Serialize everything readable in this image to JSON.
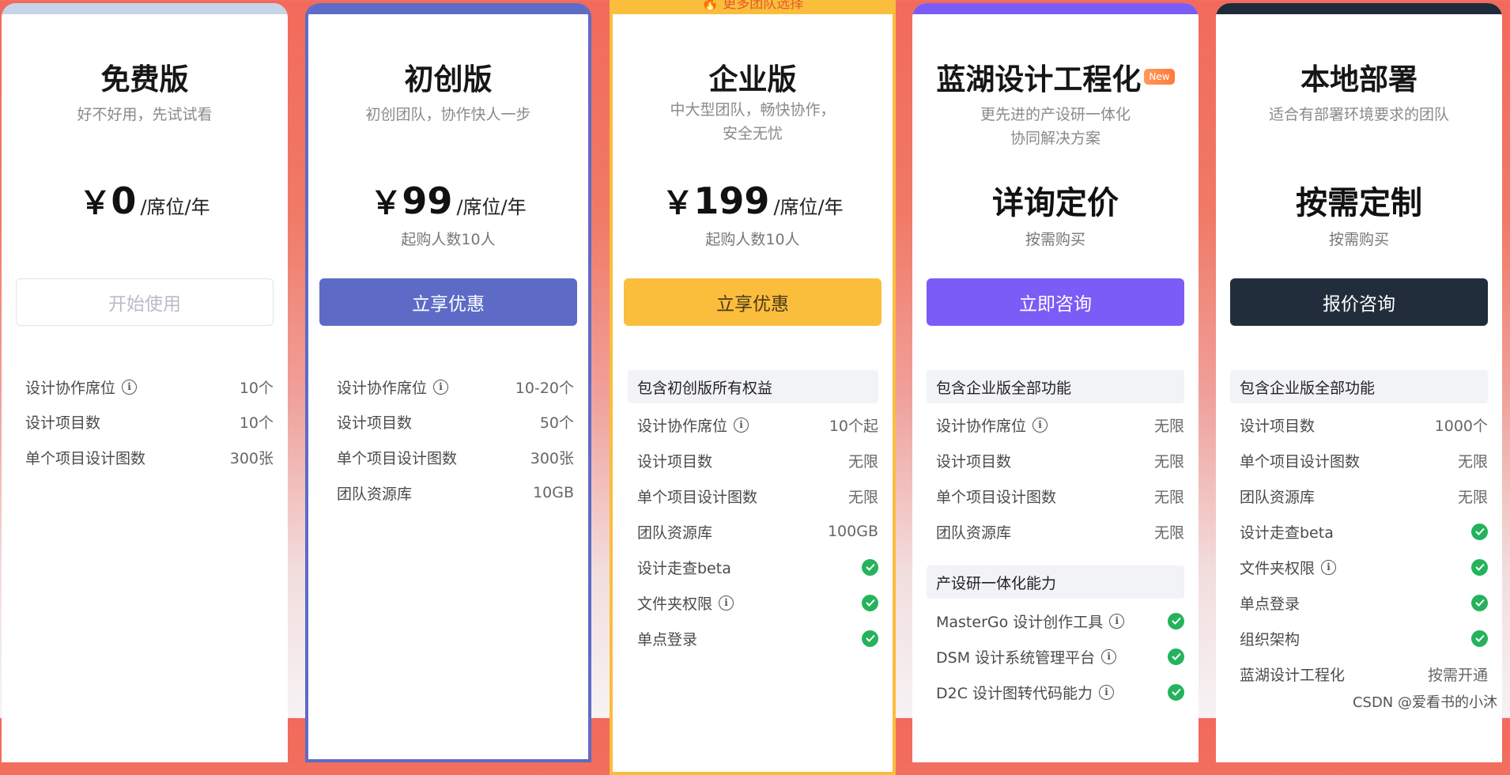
{
  "colors": {
    "free_accent": "#c7d3e6",
    "starter_accent": "#5d6bc6",
    "enterprise_accent": "#fbbd3c",
    "lanhu_accent": "#7b5cf6",
    "local_accent": "#1f2a3a",
    "check_green": "#24b35c"
  },
  "plans": {
    "free": {
      "name": "免费版",
      "desc": "好不好用，先试试看",
      "currency": "￥",
      "amount": "0",
      "unit": "/席位/年",
      "button": "开始使用",
      "features": [
        {
          "label": "设计协作席位",
          "value": "10个"
        },
        {
          "label": "设计项目数",
          "value": "10个"
        },
        {
          "label": "单个项目设计图数",
          "value": "300张"
        }
      ]
    },
    "starter": {
      "name": "初创版",
      "desc": "初创团队，协作快人一步",
      "currency": "￥",
      "amount": "99",
      "unit": "/席位/年",
      "note": "起购人数10人",
      "button": "立享优惠",
      "features": [
        {
          "label": "设计协作席位",
          "value": "10-20个"
        },
        {
          "label": "设计项目数",
          "value": "50个"
        },
        {
          "label": "单个项目设计图数",
          "value": "300张"
        },
        {
          "label": "团队资源库",
          "value": "10GB"
        }
      ]
    },
    "enterprise": {
      "name": "企业版",
      "desc": "中大型团队，畅快协作，\n安全无忧",
      "currency": "￥",
      "amount": "199",
      "unit": "/席位/年",
      "note": "起购人数10人",
      "button": "立享优惠",
      "section": "包含初创版所有权益",
      "features": [
        {
          "label": "设计协作席位",
          "value": "10个起"
        },
        {
          "label": "设计项目数",
          "value": "无限"
        },
        {
          "label": "单个项目设计图数",
          "value": "无限"
        },
        {
          "label": "团队资源库",
          "value": "100GB"
        },
        {
          "label": "设计走查beta",
          "value": ""
        },
        {
          "label": "文件夹权限",
          "value": ""
        },
        {
          "label": "单点登录",
          "value": ""
        }
      ]
    },
    "lanhu": {
      "name": "蓝湖设计工程化",
      "badge": "New",
      "desc": "更先进的产设研一体化\n协同解决方案",
      "price_text": "详询定价",
      "note": "按需购买",
      "button": "立即咨询",
      "section1": "包含企业版全部功能",
      "features": [
        {
          "label": "设计协作席位",
          "value": "无限"
        },
        {
          "label": "设计项目数",
          "value": "无限"
        },
        {
          "label": "单个项目设计图数",
          "value": "无限"
        },
        {
          "label": "团队资源库",
          "value": "无限"
        }
      ],
      "section2": "产设研一体化能力",
      "features2": [
        {
          "label": "MasterGo 设计创作工具",
          "value": ""
        },
        {
          "label": "DSM 设计系统管理平台",
          "value": ""
        },
        {
          "label": "D2C 设计图转代码能力",
          "value": ""
        }
      ]
    },
    "local": {
      "name": "本地部署",
      "desc": "适合有部署环境要求的团队",
      "price_text": "按需定制",
      "note": "按需购买",
      "button": "报价咨询",
      "section": "包含企业版全部功能",
      "features": [
        {
          "label": "设计项目数",
          "value": "1000个"
        },
        {
          "label": "单个项目设计图数",
          "value": "无限"
        },
        {
          "label": "团队资源库",
          "value": "无限"
        },
        {
          "label": "设计走查beta",
          "value": ""
        },
        {
          "label": "文件夹权限",
          "value": ""
        },
        {
          "label": "单点登录",
          "value": ""
        },
        {
          "label": "组织架构",
          "value": ""
        },
        {
          "label": "蓝湖设计工程化",
          "value": "按需开通"
        }
      ]
    }
  },
  "promo_text": "更多团队选择",
  "watermark": "CSDN @爱看书的小沐"
}
